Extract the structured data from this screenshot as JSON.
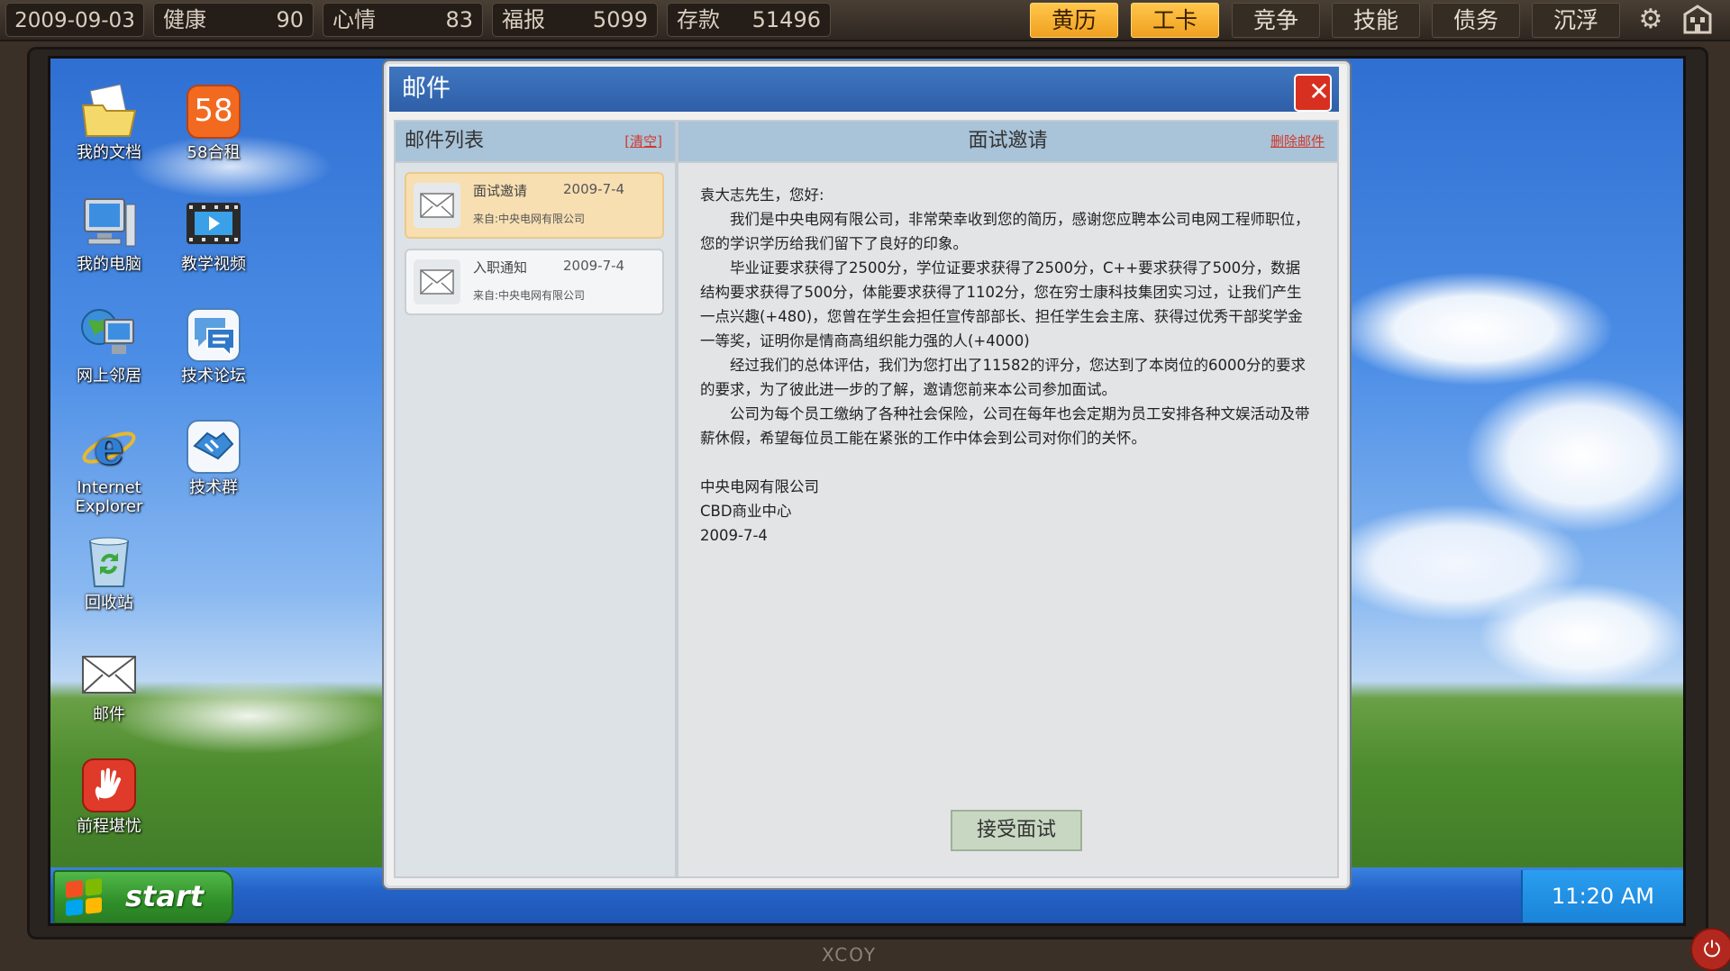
{
  "status": {
    "date": "2009-09-03",
    "health_label": "健康",
    "health_value": "90",
    "mood_label": "心情",
    "mood_value": "83",
    "karma_label": "福报",
    "karma_value": "5099",
    "savings_label": "存款",
    "savings_value": "51496"
  },
  "top_buttons": {
    "almanac": "黄历",
    "job": "工卡",
    "compete": "竞争",
    "skills": "技能",
    "debt": "债务",
    "life": "沉浮"
  },
  "icons": {
    "settings": "gear-icon",
    "home": "building-icon",
    "power": "power-icon"
  },
  "desktop": {
    "my_docs": "我的文档",
    "rent58": "58合租",
    "rent58_badge": "58",
    "my_computer": "我的电脑",
    "tutorial_video": "教学视频",
    "network": "网上邻居",
    "tech_forum": "技术论坛",
    "ie_line1": "Internet",
    "ie_line2": "Explorer",
    "tech_group": "技术群",
    "recycle": "回收站",
    "mail": "邮件",
    "career": "前程堪忧"
  },
  "taskbar": {
    "start": "start",
    "clock": "11:20 AM"
  },
  "mail_window": {
    "title": "邮件",
    "list_title": "邮件列表",
    "clear_link": "[清空]",
    "items": [
      {
        "subject": "面试邀请",
        "date": "2009-7-4",
        "from": "来自:中央电网有限公司",
        "selected": true
      },
      {
        "subject": "入职通知",
        "date": "2009-7-4",
        "from": "来自:中央电网有限公司",
        "selected": false
      }
    ],
    "detail_title": "面试邀请",
    "delete_link": "删除邮件",
    "body": {
      "greeting": "袁大志先生，您好:",
      "p1": "我们是中央电网有限公司，非常荣幸收到您的简历，感谢您应聘本公司电网工程师职位，您的学识学历给我们留下了良好的印象。",
      "p2": "毕业证要求获得了2500分，学位证要求获得了2500分，C++要求获得了500分，数据结构要求获得了500分，体能要求获得了1102分，您在穷士康科技集团实习过，让我们产生一点兴趣(+480)，您曾在学生会担任宣传部部长、担任学生会主席、获得过优秀干部奖学金一等奖，证明你是情商高组织能力强的人(+4000)",
      "p3": "经过我们的总体评估，我们为您打出了11582的评分，您达到了本岗位的6000分的要求的要求，为了彼此进一步的了解，邀请您前来本公司参加面试。",
      "p4": "公司为每个员工缴纳了各种社会保险，公司在每年也会定期为员工安排各种文娱活动及带薪休假，希望每位员工能在紧张的工作中体会到公司对你们的关怀。",
      "sign_company": "中央电网有限公司",
      "sign_place": "CBD商业中心",
      "sign_date": "2009-7-4"
    },
    "accept_button": "接受面试"
  },
  "bottom_logo": "XCOY"
}
